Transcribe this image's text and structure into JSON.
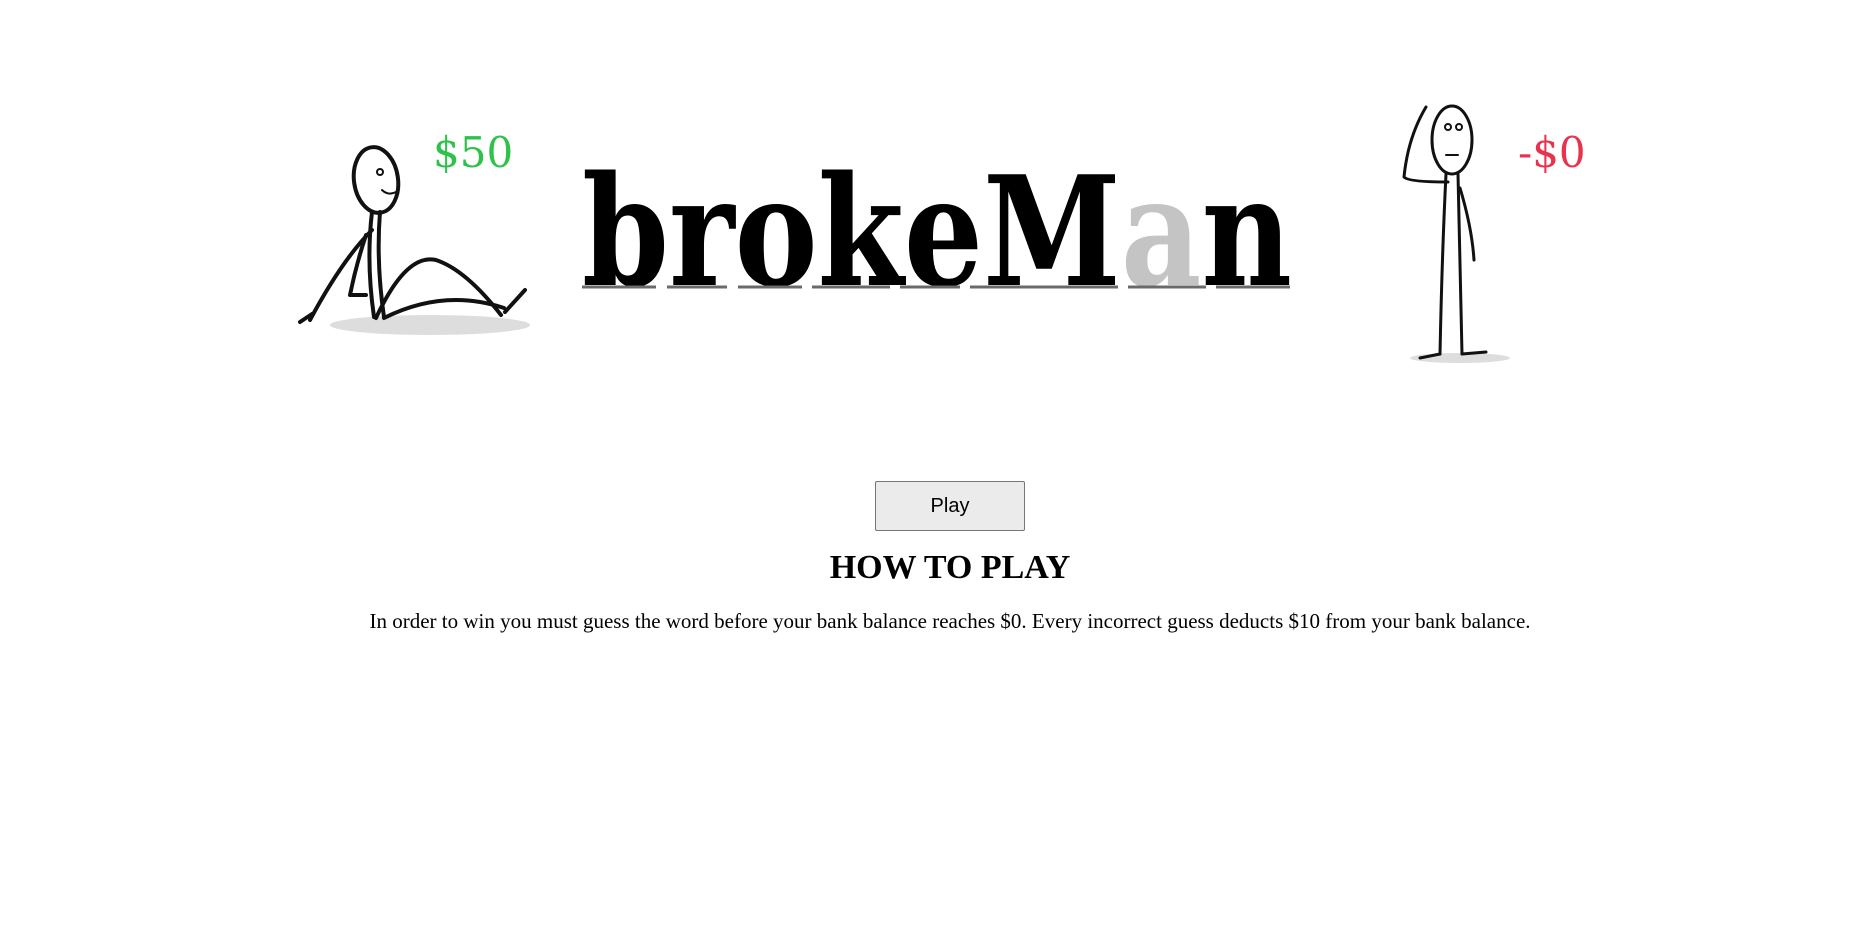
{
  "banner": {
    "logo_parts": [
      "brokeM",
      "a",
      "n"
    ],
    "left_money": "$50",
    "right_money": "-$0",
    "colors": {
      "logo": "#000000",
      "hidden_letter": "#c4c4c4",
      "left_money": "#2ec24a",
      "right_money": "#e8334f"
    },
    "left_figure_icon": "sitting-stick-figure",
    "right_figure_icon": "scratching-head-stick-figure"
  },
  "controls": {
    "play_label": "Play"
  },
  "instructions": {
    "title": "HOW TO PLAY",
    "text": "In order to win you must guess the word before your bank balance reaches $0. Every incorrect guess deducts $10 from your bank balance."
  }
}
